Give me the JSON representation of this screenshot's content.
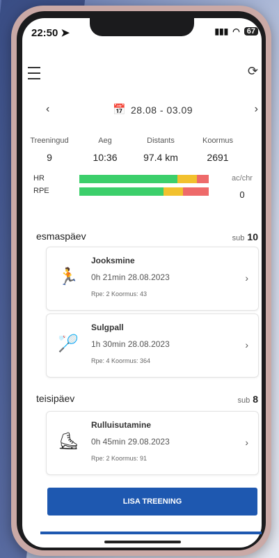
{
  "status": {
    "time": "22:50",
    "location_icon": "location-arrow-icon",
    "signal": "signal-icon",
    "wifi": "wifi-icon",
    "battery": "67"
  },
  "header": {
    "menu_icon": "menu-icon",
    "sync_icon": "sync-icon"
  },
  "week": {
    "range": "28.08 - 03.09",
    "prev": "‹",
    "next": "›"
  },
  "stats": [
    {
      "label": "Treeningud",
      "value": "9"
    },
    {
      "label": "Aeg",
      "value": "10:36"
    },
    {
      "label": "Distants",
      "value": "97.4 km"
    },
    {
      "label": "Koormus",
      "value": "2691"
    }
  ],
  "intensity": {
    "hr_label": "HR",
    "rpe_label": "RPE",
    "hr_distribution": {
      "green": 0.76,
      "yellow": 0.15,
      "red": 0.09
    },
    "rpe_distribution": {
      "green": 0.65,
      "yellow": 0.15,
      "red": 0.2
    },
    "acwr_label": "ac/chr",
    "acwr_value": "0"
  },
  "days": [
    {
      "name": "esmaspäev",
      "sub_label": "sub",
      "sub_value": "10"
    },
    {
      "name": "teisipäev",
      "sub_label": "sub",
      "sub_value": "8"
    }
  ],
  "workouts": [
    {
      "title": "Jooksmine",
      "info": "0h 21min 28.08.2023",
      "meta": "Rpe: 2  Koormus: 43",
      "icon": "running-icon"
    },
    {
      "title": "Sulgpall",
      "info": "1h 30min 28.08.2023",
      "meta": "Rpe: 4  Koormus: 364",
      "icon": "badminton-icon"
    },
    {
      "title": "Rulluisutamine",
      "info": "0h 45min 29.08.2023",
      "meta": "Rpe: 2  Koormus: 91",
      "icon": "rollerskate-icon"
    }
  ],
  "add_button": "LISA TREENING",
  "colors": {
    "accent": "#1e58b0",
    "green": "#3ccf6b",
    "yellow": "#f2c12e",
    "red": "#ee6a6a"
  }
}
